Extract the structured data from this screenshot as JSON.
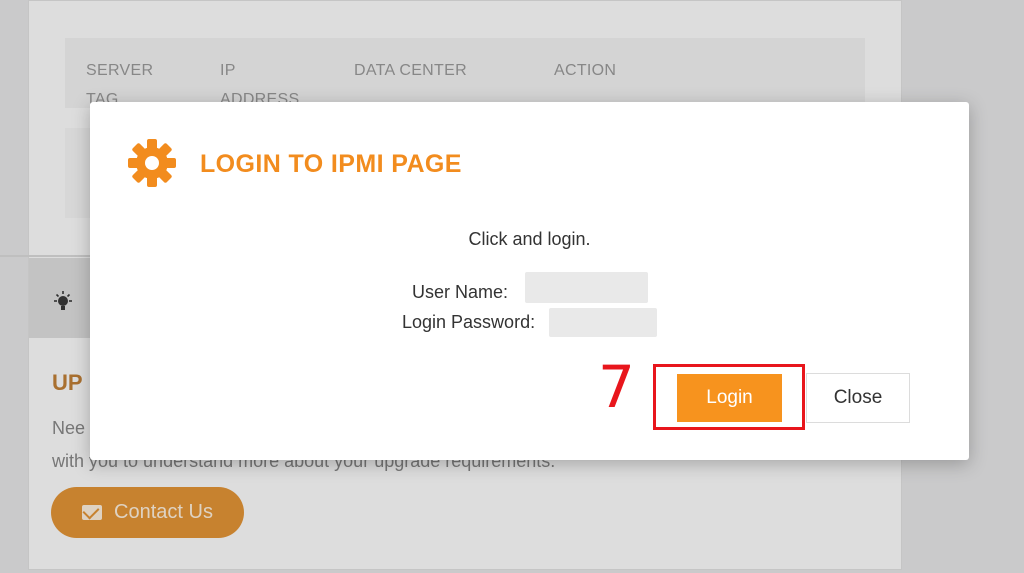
{
  "background": {
    "table_headers": [
      "SERVER TAG",
      "IP ADDRESS",
      "DATA CENTER",
      "ACTION"
    ],
    "table_headers_lines": [
      [
        "SERVER",
        "TAG"
      ],
      [
        "IP",
        "ADDRESS"
      ],
      [
        "DATA CENTER"
      ],
      [
        "ACTION"
      ]
    ],
    "upgrade_title": "UP",
    "upgrade_text_line1": "Nee",
    "upgrade_text_line2": "with you to understand more about your upgrade requirements.",
    "contact_button_label": "Contact Us",
    "contact_icon": "envelope-icon",
    "tip_icon": "lightbulb-icon"
  },
  "modal": {
    "title": "LOGIN TO IPMI PAGE",
    "title_icon": "gear-icon",
    "message": "Click and login.",
    "username_label": "User Name:",
    "password_label": "Login Password:",
    "login_button_label": "Login",
    "close_button_label": "Close"
  },
  "annotation": {
    "step_number": "7"
  },
  "colors": {
    "accent": "#f7931e",
    "title": "#f28c1e",
    "annotation": "#e8161c"
  }
}
